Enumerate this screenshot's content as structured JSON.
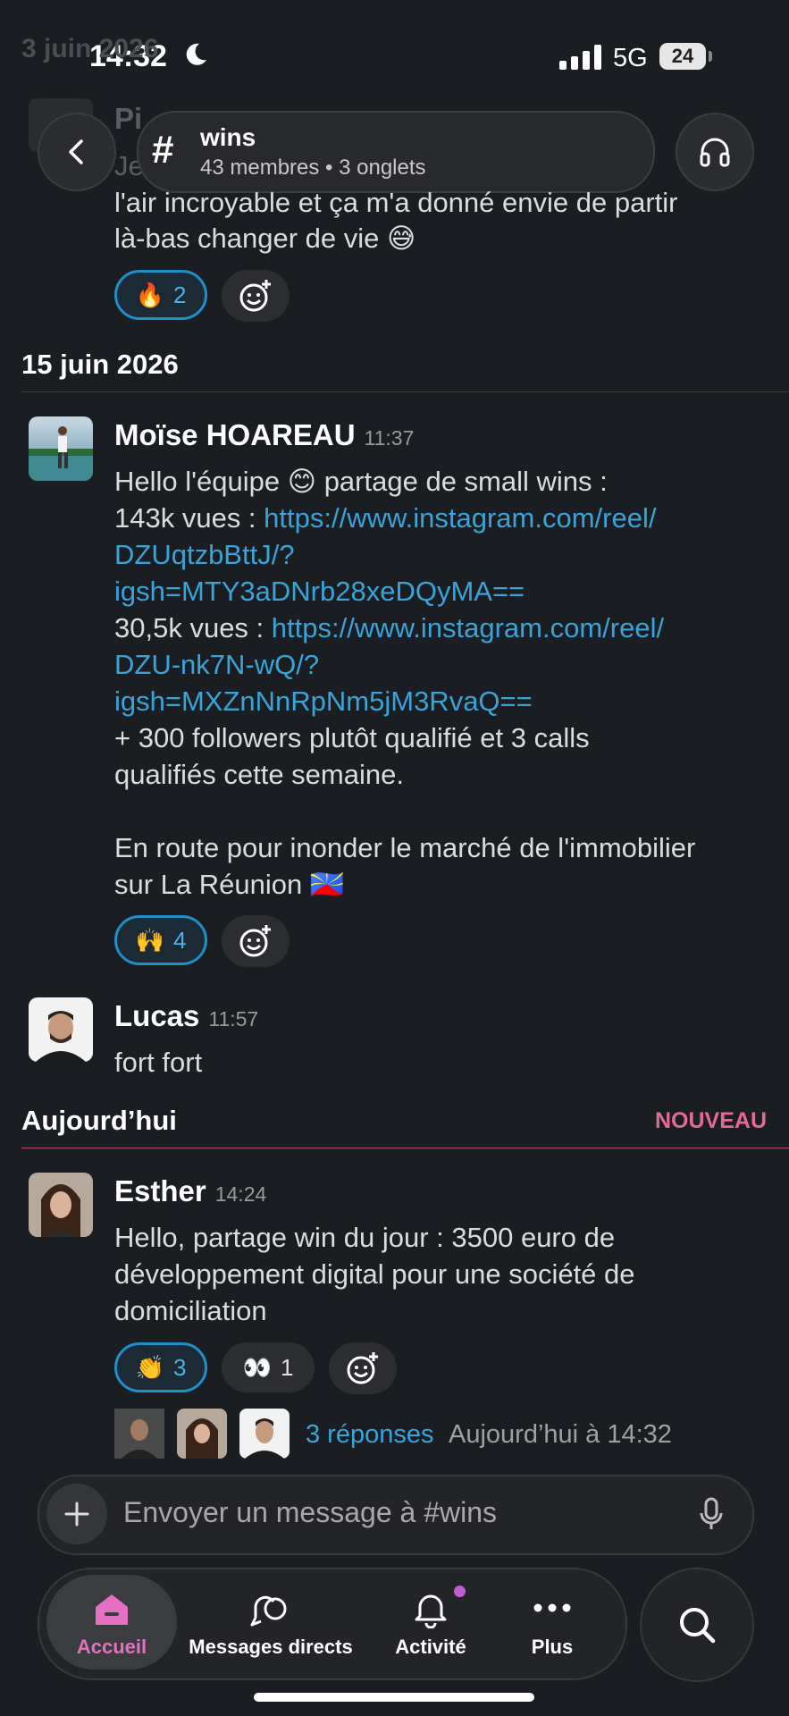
{
  "status": {
    "time": "14:32",
    "network": "5G",
    "battery": "24"
  },
  "background_header": {
    "date": "3 juin 2026",
    "author_fragment": "Pi",
    "text_fragment": "Je"
  },
  "header": {
    "channel_name": "wins",
    "channel_sub": "43 membres • 3 onglets",
    "hash": "#"
  },
  "messages_top": {
    "line1": "l'air incroyable et ça m'a donné envie de partir",
    "line2": "là-bas changer de vie 😅",
    "reaction_emoji": "🔥",
    "reaction_count": "2"
  },
  "date_separator_1": "15 juin 2026",
  "msg_moise": {
    "author": "Moïse HOAREAU",
    "time": "11:37",
    "l1": "Hello l'équipe 😊 partage de small wins :",
    "l2_prefix": "143k vues : ",
    "l2_link": "https://www.instagram.com/reel/",
    "l3_link": "DZUqtzbBttJ/?",
    "l4_link": "igsh=MTY3aDNrb28xeDQyMA==",
    "l5_prefix": "30,5k vues : ",
    "l5_link": "https://www.instagram.com/reel/",
    "l6_link": "DZU-nk7N-wQ/?",
    "l7_link": "igsh=MXZnNnRpNm5jM3RvaQ==",
    "l8": "+ 300 followers plutôt qualifié et 3 calls",
    "l9": "qualifiés cette semaine.",
    "l10": "En route pour inonder le marché de l'immobilier",
    "l11": "sur La Réunion 🇷🇪",
    "reaction_emoji": "🙌",
    "reaction_count": "4"
  },
  "msg_lucas": {
    "author": "Lucas",
    "time": "11:57",
    "text": "fort fort"
  },
  "date_separator_2": "Aujourd’hui",
  "new_label": "NOUVEAU",
  "msg_esther": {
    "author": "Esther",
    "time": "14:24",
    "l1": "Hello, partage win du jour : 3500 euro de",
    "l2": "développement digital pour une société de",
    "l3": "domiciliation",
    "reactions": [
      {
        "emoji": "👏",
        "count": "3"
      },
      {
        "emoji": "👀",
        "count": "1"
      }
    ],
    "replies": "3 réponses",
    "replies_time": "Aujourd’hui à 14:32"
  },
  "composer": {
    "placeholder": "Envoyer un message à #wins"
  },
  "tabs": [
    {
      "label": "Accueil",
      "icon": "home-icon"
    },
    {
      "label": "Messages directs",
      "icon": "messages-icon"
    },
    {
      "label": "Activité",
      "icon": "bell-icon"
    },
    {
      "label": "Plus",
      "icon": "more-icon"
    }
  ],
  "colors": {
    "background": "#1a1d21",
    "link": "#3aa3d8",
    "accent_new": "#e36a92",
    "active_tab": "#e56fc0"
  }
}
